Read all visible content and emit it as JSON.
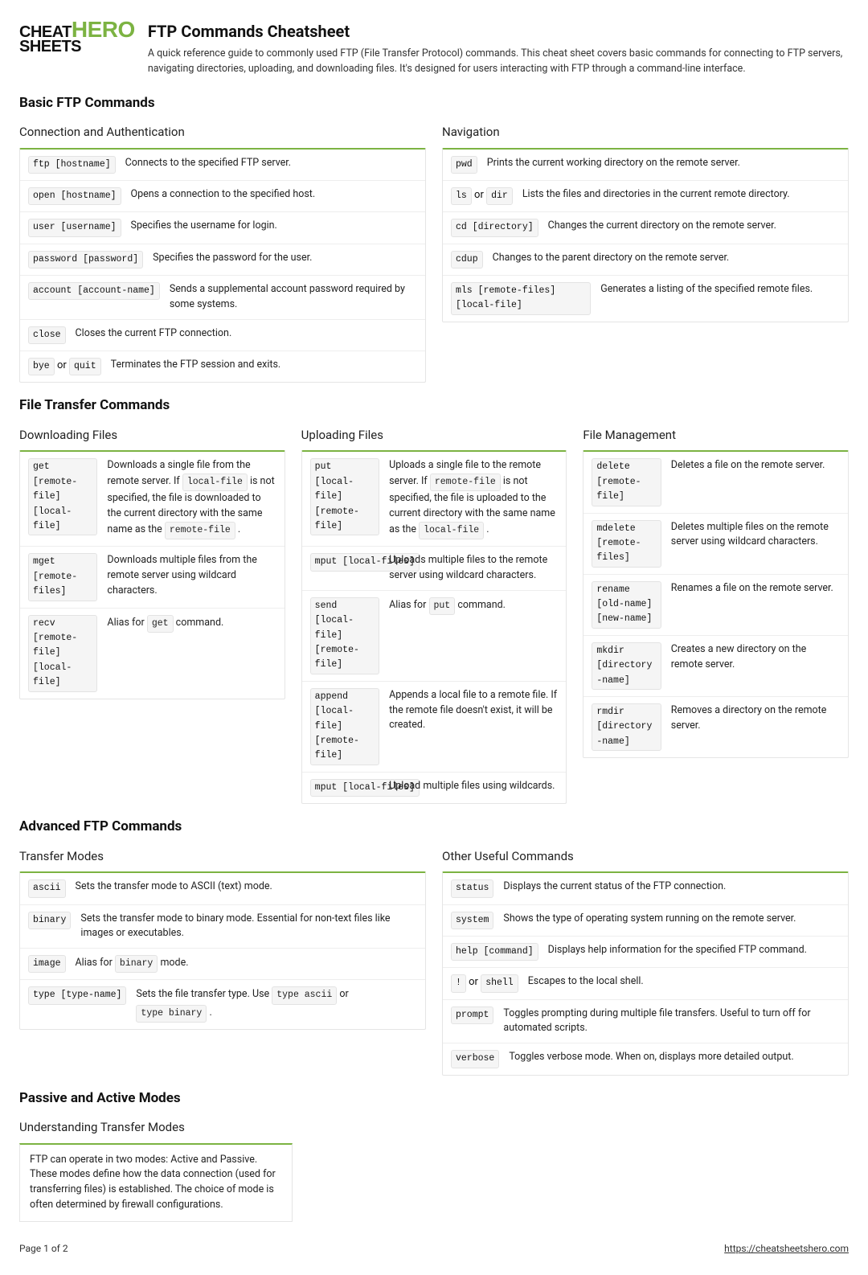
{
  "logo": {
    "line1": "CHEAT",
    "line2": "SHEETS",
    "hero": "HERO"
  },
  "header": {
    "title": "FTP Commands Cheatsheet",
    "subtitle": "A quick reference guide to commonly used FTP (File Transfer Protocol) commands. This cheat sheet covers basic commands for connecting to FTP servers, navigating directories, uploading, and downloading files. It's designed for users interacting with FTP through a command-line interface."
  },
  "sections": [
    {
      "title": "Basic FTP Commands",
      "rows": [
        [
          {
            "title": "Connection and Authentication",
            "items": [
              {
                "cmd": [
                  "ftp [hostname]"
                ],
                "desc": "Connects to the specified FTP server."
              },
              {
                "cmd": [
                  "open [hostname]"
                ],
                "desc": "Opens a connection to the specified host."
              },
              {
                "cmd": [
                  "user [username]"
                ],
                "desc": "Specifies the username for login."
              },
              {
                "cmd": [
                  "password [password]"
                ],
                "desc": "Specifies the password for the user."
              },
              {
                "cmd": [
                  "account [account-name]"
                ],
                "desc": "Sends a supplemental account password required by some systems."
              },
              {
                "cmd": [
                  "close"
                ],
                "desc": "Closes the current FTP connection."
              },
              {
                "cmd": [
                  "bye",
                  " or ",
                  "quit"
                ],
                "desc": "Terminates the FTP session and exits."
              }
            ]
          },
          {
            "title": "Navigation",
            "items": [
              {
                "cmd": [
                  "pwd"
                ],
                "desc": "Prints the current working directory on the remote server."
              },
              {
                "cmd": [
                  "ls",
                  " or ",
                  "dir"
                ],
                "desc": "Lists the files and directories in the current remote directory."
              },
              {
                "cmd": [
                  "cd [directory]"
                ],
                "desc": "Changes the current directory on the remote server."
              },
              {
                "cmd": [
                  "cdup"
                ],
                "desc": "Changes to the parent directory on the remote server."
              },
              {
                "cmd": [
                  "mls [remote-files] [local-file]"
                ],
                "desc": "Generates a listing of the specified remote files."
              }
            ]
          }
        ]
      ]
    },
    {
      "title": "File Transfer Commands",
      "rows": [
        [
          {
            "title": "Downloading Files",
            "items": [
              {
                "cmd": [
                  "get [remote-file] [local-file]"
                ],
                "desc": [
                  "Downloads a single file from the remote server. If ",
                  {
                    "c": "local-file"
                  },
                  " is not specified, the file is downloaded to the current directory with the same name as the ",
                  {
                    "c": "remote-file"
                  },
                  " ."
                ]
              },
              {
                "cmd": [
                  "mget [remote-files]"
                ],
                "desc": "Downloads multiple files from the remote server using wildcard characters."
              },
              {
                "cmd": [
                  "recv [remote-file] [local-file]"
                ],
                "desc": [
                  "Alias for ",
                  {
                    "c": "get"
                  },
                  " command."
                ]
              }
            ]
          },
          {
            "title": "Uploading Files",
            "items": [
              {
                "cmd": [
                  "put [local-file] [remote-file]"
                ],
                "desc": [
                  "Uploads a single file to the remote server. If ",
                  {
                    "c": "remote-file"
                  },
                  " is not specified, the file is uploaded to the current directory with the same name as the ",
                  {
                    "c": "local-file"
                  },
                  " ."
                ]
              },
              {
                "cmd": [
                  "mput [local-files]"
                ],
                "desc": "Uploads multiple files to the remote server using wildcard characters."
              },
              {
                "cmd": [
                  "send [local-file] [remote-file]"
                ],
                "desc": [
                  "Alias for ",
                  {
                    "c": "put"
                  },
                  " command."
                ]
              },
              {
                "cmd": [
                  "append [local-file] [remote-file]"
                ],
                "desc": "Appends a local file to a remote file. If the remote file doesn't exist, it will be created."
              },
              {
                "cmd": [
                  "mput [local-files]"
                ],
                "desc": "Upload multiple files using wildcards."
              }
            ]
          },
          {
            "title": "File Management",
            "items": [
              {
                "cmd": [
                  "delete [remote-file]"
                ],
                "desc": "Deletes a file on the remote server."
              },
              {
                "cmd": [
                  "mdelete [remote-files]"
                ],
                "desc": "Deletes multiple files on the remote server using wildcard characters."
              },
              {
                "cmd": [
                  "rename [old-name] [new-name]"
                ],
                "desc": "Renames a file on the remote server."
              },
              {
                "cmd": [
                  "mkdir [directory-name]"
                ],
                "desc": "Creates a new directory on the remote server."
              },
              {
                "cmd": [
                  "rmdir [directory-name]"
                ],
                "desc": "Removes a directory on the remote server."
              }
            ]
          }
        ]
      ]
    },
    {
      "title": "Advanced FTP Commands",
      "rows": [
        [
          {
            "title": "Transfer Modes",
            "items": [
              {
                "cmd": [
                  "ascii"
                ],
                "desc": "Sets the transfer mode to ASCII (text) mode."
              },
              {
                "cmd": [
                  "binary"
                ],
                "desc": "Sets the transfer mode to binary mode. Essential for non-text files like images or executables."
              },
              {
                "cmd": [
                  "image"
                ],
                "desc": [
                  "Alias for ",
                  {
                    "c": "binary"
                  },
                  " mode."
                ]
              },
              {
                "cmd": [
                  "type [type-name]"
                ],
                "desc": [
                  "Sets the file transfer type. Use ",
                  {
                    "c": "type ascii"
                  },
                  " or ",
                  {
                    "c": "type binary"
                  },
                  " ."
                ]
              }
            ]
          },
          {
            "title": "Other Useful Commands",
            "items": [
              {
                "cmd": [
                  "status"
                ],
                "desc": "Displays the current status of the FTP connection."
              },
              {
                "cmd": [
                  "system"
                ],
                "desc": "Shows the type of operating system running on the remote server."
              },
              {
                "cmd": [
                  "help [command]"
                ],
                "desc": "Displays help information for the specified FTP command."
              },
              {
                "cmd": [
                  "!",
                  " or ",
                  "shell"
                ],
                "desc": "Escapes to the local shell."
              },
              {
                "cmd": [
                  "prompt"
                ],
                "desc": "Toggles prompting during multiple file transfers. Useful to turn off for automated scripts."
              },
              {
                "cmd": [
                  "verbose"
                ],
                "desc": "Toggles verbose mode. When on, displays more detailed output."
              }
            ]
          }
        ]
      ]
    },
    {
      "title": "Passive and Active Modes",
      "rows": [
        [
          {
            "title": "Understanding Transfer Modes",
            "text": "FTP can operate in two modes: Active and Passive. These modes define how the data connection (used for transferring files) is established. The choice of mode is often determined by firewall configurations."
          }
        ]
      ]
    }
  ],
  "footer": {
    "page": "Page 1 of 2",
    "url": "https://cheatsheetshero.com"
  }
}
